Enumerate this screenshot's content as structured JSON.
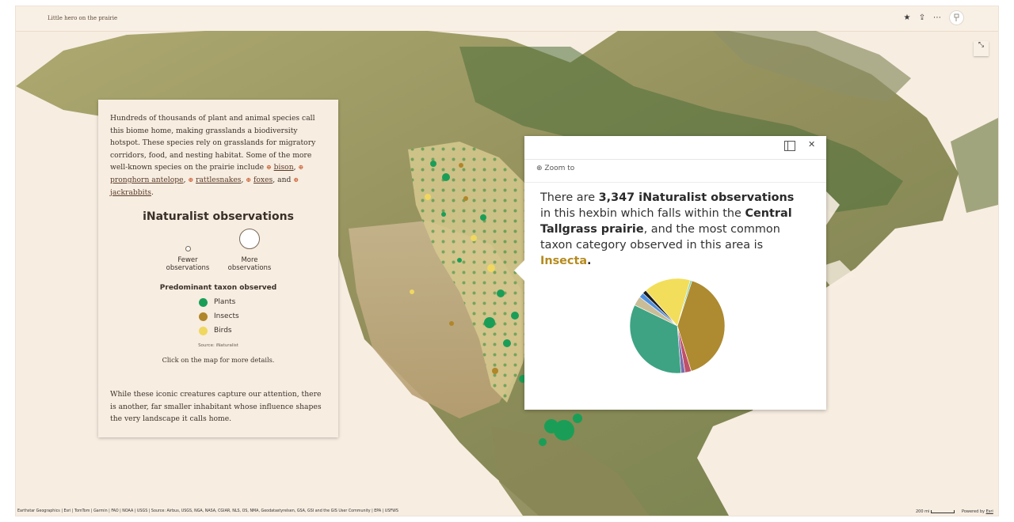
{
  "header": {
    "title": "Little hero on the prairie",
    "favorite_icon": "star-icon",
    "share_icon": "share-icon",
    "more_icon": "more-icon"
  },
  "map": {
    "expand_icon": "expand-icon",
    "hex_colors": {
      "plants": "#2e9e5f",
      "insects": "#b68b2c",
      "birds": "#f0d75a",
      "grid": "#c9b97a"
    }
  },
  "panel": {
    "intro_text": "Hundreds of thousands of plant and animal species call this biome home, making grasslands a biodiversity hotspot. These species rely on grasslands for migratory corridors, food, and nesting habitat. Some of the more well-known species on the prairie include",
    "links": {
      "bison": "bison",
      "pronghorn": "pronghorn antelope",
      "rattlesnakes": "rattlesnakes",
      "foxes": "foxes",
      "jackrabbits": "jackrabbits"
    },
    "and": "and",
    "legend": {
      "title": "iNaturalist observations",
      "fewer": "Fewer observations",
      "more": "More observations",
      "taxon_title": "Predominant taxon observed",
      "items": [
        {
          "label": "Plants",
          "color": "#1a9e57"
        },
        {
          "label": "Insects",
          "color": "#b0862a"
        },
        {
          "label": "Birds",
          "color": "#f0d760"
        }
      ],
      "source": "Source: iNaturalist",
      "click_msg": "Click on the map for more details."
    },
    "outro_text": "While these iconic creatures capture our attention, there is another, far smaller inhabitant whose influence shapes the very landscape it calls home."
  },
  "popup": {
    "dock_icon": "dock-icon",
    "close_icon": "close-icon",
    "zoom_to": "Zoom to",
    "text_1": "There are",
    "obs_count": "3,347 iNaturalist observations",
    "text_2": "in this hexbin which falls within the",
    "region": "Central Tallgrass prairie",
    "text_3": ", and the most common taxon category observed in this area is",
    "taxon": "Insecta",
    "text_4": "."
  },
  "chart_data": {
    "type": "pie",
    "values": [
      40.3,
      2.1,
      1.4,
      33.5,
      3.2,
      1.7,
      1.3,
      16.0,
      0.6
    ],
    "colors": [
      "#ae8a30",
      "#c0506a",
      "#7b6fae",
      "#3da383",
      "#c9bd98",
      "#4f8fe0",
      "#1c1c1c",
      "#f2de5a",
      "#7fd5b0"
    ]
  },
  "footer": {
    "attribution": "Earthstar Geographics | Esri | TomTom | Garmin | FAO | NOAA | USGS | Source: Airbus, USGS, NGA, NASA, CGIAR, NLS, OS, NMA, Geodatastyrelsen, GSA, GSI and the GIS User Community | EPA | USFWS",
    "scale_label": "200 mi",
    "powered_by": "Powered by",
    "esri": "Esri"
  }
}
